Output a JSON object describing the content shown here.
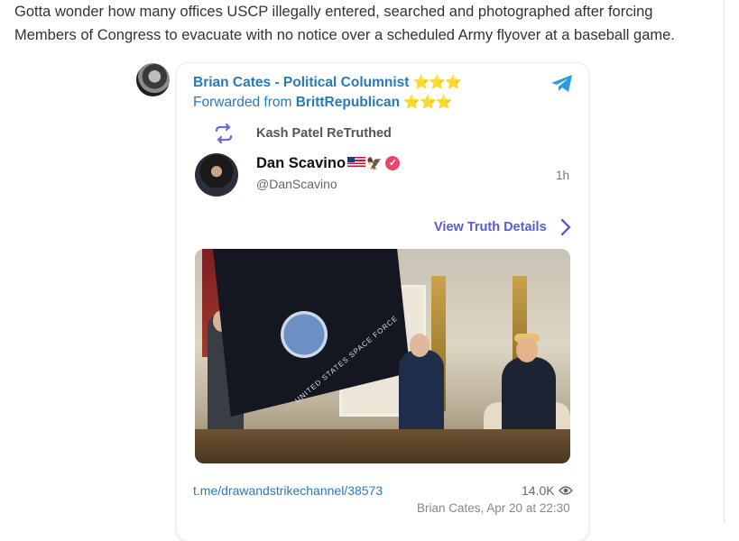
{
  "post": {
    "text": "Gotta wonder how many offices USCP illegally entered, searched and photographed after forcing Members of Congress to evacuate with no notice over a scheduled Army flyover at a baseball game."
  },
  "telegram": {
    "channel_name": "Brian Cates - Political Columnist",
    "channel_stars": "⭐⭐⭐",
    "forwarded_prefix": "Forwarded from ",
    "forwarded_from": "BrittRepublican",
    "forwarded_stars": "⭐⭐⭐",
    "link": "t.me/drawandstrikechannel/38573",
    "views": "14.0K",
    "footer": "Brian Cates, Apr 20 at 22:30"
  },
  "truth": {
    "retruth_label": "Kash Patel ReTruthed",
    "author_name": "Dan Scavino",
    "author_handle": "@DanScavino",
    "time": "1h",
    "view_details_label": "View Truth Details",
    "image_flag_text": "UNITED STATES SPACE FORCE"
  },
  "icons": {
    "telegram": "telegram-send-icon",
    "retruth": "retruth-icon",
    "verified": "verified-badge-icon",
    "chevron": "chevron-right-icon",
    "eye": "eye-icon"
  },
  "colors": {
    "link_blue": "#2a7ab8",
    "truth_purple": "#5a5ad6",
    "verified_pink": "#e9446a",
    "star_gold": "#f0b400"
  }
}
